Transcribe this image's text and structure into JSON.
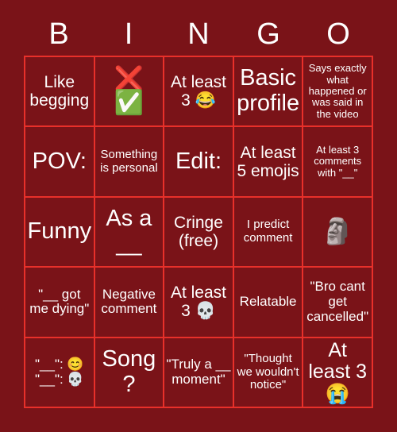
{
  "header": {
    "letters": [
      "B",
      "I",
      "N",
      "G",
      "O"
    ]
  },
  "colors": {
    "background": "#7a1318",
    "grid_line": "#e8302a",
    "text": "#ffffff"
  },
  "grid": {
    "rows": 5,
    "columns": 5,
    "cells": [
      {
        "text": "Like begging",
        "size": "fs-l"
      },
      {
        "text": "❌\n✅",
        "size": "emoji-stack"
      },
      {
        "text": "At least 3 😂",
        "size": "fs-l"
      },
      {
        "text": "Basic profile",
        "size": "fs-xxl"
      },
      {
        "text": "Says exactly what happened or was said in the video",
        "size": "fs-xs"
      },
      {
        "text": "POV:",
        "size": "fs-xxl"
      },
      {
        "text": "Something is personal",
        "size": "fs-s"
      },
      {
        "text": "Edit:",
        "size": "fs-xxl"
      },
      {
        "text": "At least 5 emojis",
        "size": "fs-l"
      },
      {
        "text": "At least 3 comments with \"__\"",
        "size": "fs-xs"
      },
      {
        "text": "Funny",
        "size": "fs-xxl"
      },
      {
        "text": "As a __",
        "size": "fs-xxl"
      },
      {
        "text": "Cringe (free)",
        "size": "fs-l"
      },
      {
        "text": "I predict comment",
        "size": "fs-s"
      },
      {
        "text": "🗿",
        "size": "emoji-solo"
      },
      {
        "text": "\"__ got me dying\"",
        "size": "fs-m"
      },
      {
        "text": "Negative comment",
        "size": "fs-m"
      },
      {
        "text": "At least 3 💀",
        "size": "fs-l"
      },
      {
        "text": "Relatable",
        "size": "fs-m"
      },
      {
        "text": "\"Bro cant get cancelled\"",
        "size": "fs-m"
      },
      {
        "text": "\"__\": 😊\n\"__\": 💀",
        "size": "fs-m"
      },
      {
        "text": "Song?",
        "size": "fs-xxl"
      },
      {
        "text": "\"Truly a __ moment\"",
        "size": "fs-m"
      },
      {
        "text": "\"Thought we wouldn't notice\"",
        "size": "fs-s"
      },
      {
        "text": "At least 3 😭",
        "size": "fs-xl"
      }
    ]
  }
}
